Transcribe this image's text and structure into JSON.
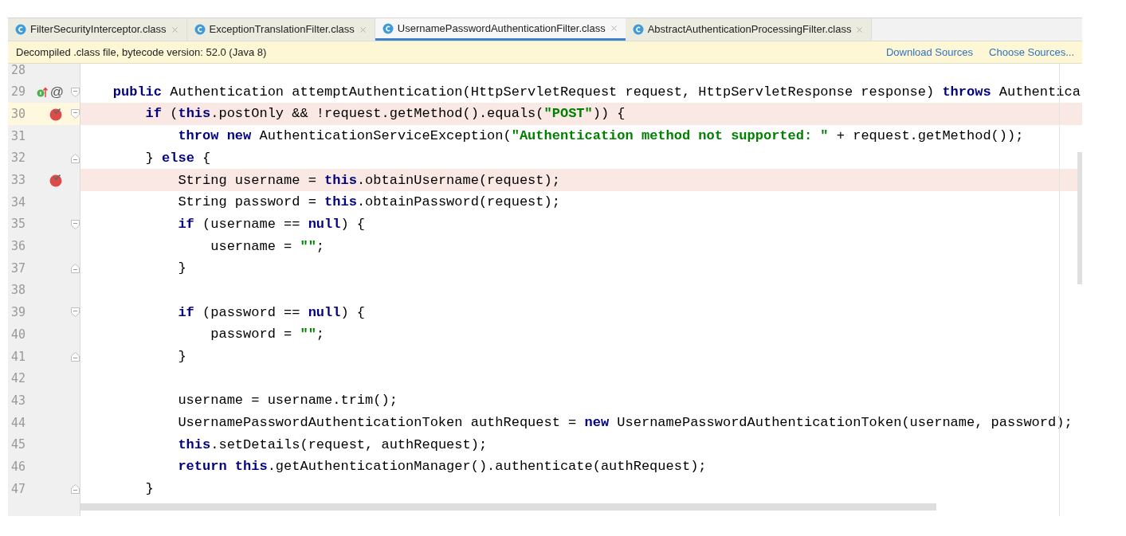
{
  "tabs": [
    {
      "label": "FilterSecurityInterceptor.class",
      "selected": false
    },
    {
      "label": "ExceptionTranslationFilter.class",
      "selected": false
    },
    {
      "label": "UsernamePasswordAuthenticationFilter.class",
      "selected": true
    },
    {
      "label": "AbstractAuthenticationProcessingFilter.class",
      "selected": false
    }
  ],
  "info_bar": {
    "message": "Decompiled .class file, bytecode version: 52.0 (Java 8)",
    "links": [
      "Download Sources",
      "Choose Sources..."
    ]
  },
  "lines": [
    {
      "number": "28",
      "breakpoint": false,
      "current": false
    },
    {
      "number": "29",
      "breakpoint": false,
      "current": false,
      "fold": {
        "kind": "start"
      },
      "gutter_icons": [
        {
          "kind": "implements"
        },
        {
          "kind": "annotation",
          "text": "@"
        }
      ],
      "tokens": [
        {
          "kind": "kw",
          "text": "    public"
        },
        {
          "kind": "plain",
          "text": " Authentication attemptAuthentication(HttpServletRequest request, HttpServletResponse response) "
        },
        {
          "kind": "kw",
          "text": "throws"
        },
        {
          "kind": "plain",
          "text": " Authentica"
        }
      ]
    },
    {
      "number": "30",
      "breakpoint": true,
      "current": true,
      "fold": {
        "kind": "start"
      },
      "tokens": [
        {
          "kind": "kw",
          "text": "        if"
        },
        {
          "kind": "plain",
          "text": " ("
        },
        {
          "kind": "kw",
          "text": "this"
        },
        {
          "kind": "plain",
          "text": ".postOnly && !request.getMethod().equals("
        },
        {
          "kind": "str",
          "text": "\"POST\""
        },
        {
          "kind": "plain",
          "text": ")) {"
        }
      ]
    },
    {
      "number": "31",
      "breakpoint": false,
      "current": false,
      "tokens": [
        {
          "kind": "kw",
          "text": "            throw new"
        },
        {
          "kind": "plain",
          "text": " AuthenticationServiceException("
        },
        {
          "kind": "str",
          "text": "\"Authentication method not supported: \""
        },
        {
          "kind": "plain",
          "text": " + request.getMethod());"
        }
      ]
    },
    {
      "number": "32",
      "breakpoint": false,
      "current": false,
      "fold": {
        "kind": "end"
      },
      "tokens": [
        {
          "kind": "plain",
          "text": "        } "
        },
        {
          "kind": "kw",
          "text": "else"
        },
        {
          "kind": "plain",
          "text": " {"
        }
      ]
    },
    {
      "number": "33",
      "breakpoint": true,
      "current": false,
      "tokens": [
        {
          "kind": "plain",
          "text": "            String username = "
        },
        {
          "kind": "kw",
          "text": "this"
        },
        {
          "kind": "plain",
          "text": ".obtainUsername(request);"
        }
      ]
    },
    {
      "number": "34",
      "breakpoint": false,
      "current": false,
      "tokens": [
        {
          "kind": "plain",
          "text": "            String password = "
        },
        {
          "kind": "kw",
          "text": "this"
        },
        {
          "kind": "plain",
          "text": ".obtainPassword(request);"
        }
      ]
    },
    {
      "number": "35",
      "breakpoint": false,
      "current": false,
      "fold": {
        "kind": "start"
      },
      "tokens": [
        {
          "kind": "kw",
          "text": "            if"
        },
        {
          "kind": "plain",
          "text": " (username == "
        },
        {
          "kind": "kw",
          "text": "null"
        },
        {
          "kind": "plain",
          "text": ") {"
        }
      ]
    },
    {
      "number": "36",
      "breakpoint": false,
      "current": false,
      "tokens": [
        {
          "kind": "plain",
          "text": "                username = "
        },
        {
          "kind": "str",
          "text": "\"\""
        },
        {
          "kind": "plain",
          "text": ";"
        }
      ]
    },
    {
      "number": "37",
      "breakpoint": false,
      "current": false,
      "fold": {
        "kind": "end"
      },
      "tokens": [
        {
          "kind": "plain",
          "text": "            }"
        }
      ]
    },
    {
      "number": "38",
      "breakpoint": false,
      "current": false
    },
    {
      "number": "39",
      "breakpoint": false,
      "current": false,
      "fold": {
        "kind": "start"
      },
      "tokens": [
        {
          "kind": "kw",
          "text": "            if"
        },
        {
          "kind": "plain",
          "text": " (password == "
        },
        {
          "kind": "kw",
          "text": "null"
        },
        {
          "kind": "plain",
          "text": ") {"
        }
      ]
    },
    {
      "number": "40",
      "breakpoint": false,
      "current": false,
      "tokens": [
        {
          "kind": "plain",
          "text": "                password = "
        },
        {
          "kind": "str",
          "text": "\"\""
        },
        {
          "kind": "plain",
          "text": ";"
        }
      ]
    },
    {
      "number": "41",
      "breakpoint": false,
      "current": false,
      "fold": {
        "kind": "end"
      },
      "tokens": [
        {
          "kind": "plain",
          "text": "            }"
        }
      ]
    },
    {
      "number": "42",
      "breakpoint": false,
      "current": false
    },
    {
      "number": "43",
      "breakpoint": false,
      "current": false,
      "tokens": [
        {
          "kind": "plain",
          "text": "            username = username.trim();"
        }
      ]
    },
    {
      "number": "44",
      "breakpoint": false,
      "current": false,
      "tokens": [
        {
          "kind": "plain",
          "text": "            UsernamePasswordAuthenticationToken authRequest = "
        },
        {
          "kind": "kw",
          "text": "new"
        },
        {
          "kind": "plain",
          "text": " UsernamePasswordAuthenticationToken(username, password);"
        }
      ]
    },
    {
      "number": "45",
      "breakpoint": false,
      "current": false,
      "tokens": [
        {
          "kind": "kw",
          "text": "            this"
        },
        {
          "kind": "plain",
          "text": ".setDetails(request, authRequest);"
        }
      ]
    },
    {
      "number": "46",
      "breakpoint": false,
      "current": false,
      "tokens": [
        {
          "kind": "kw",
          "text": "            return this"
        },
        {
          "kind": "plain",
          "text": ".getAuthenticationManager().authenticate(authRequest);"
        }
      ]
    },
    {
      "number": "47",
      "breakpoint": false,
      "current": false,
      "fold": {
        "kind": "end"
      },
      "tokens": [
        {
          "kind": "plain",
          "text": "        }"
        }
      ]
    }
  ]
}
